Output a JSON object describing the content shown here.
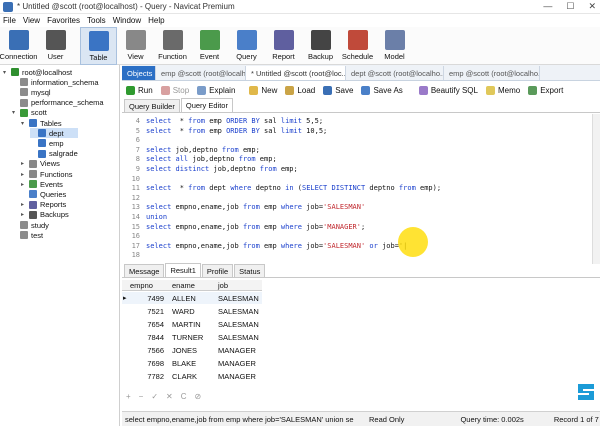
{
  "window": {
    "title": "* Untitled @scott (root@localhost) - Query - Navicat Premium",
    "min": "—",
    "max": "☐",
    "close": "✕"
  },
  "menu": [
    "File",
    "View",
    "Favorites",
    "Tools",
    "Window",
    "Help"
  ],
  "toolbar": [
    {
      "label": "Connection",
      "color": "#3a6fb5"
    },
    {
      "label": "User",
      "color": "#555555"
    },
    {
      "label": "Table",
      "color": "#3a74c4",
      "active": true
    },
    {
      "label": "View",
      "color": "#888888"
    },
    {
      "label": "Function",
      "color": "#6a6a6a"
    },
    {
      "label": "Event",
      "color": "#4b9a4b"
    },
    {
      "label": "Query",
      "color": "#4a7fc9"
    },
    {
      "label": "Report",
      "color": "#5f5f9f"
    },
    {
      "label": "Backup",
      "color": "#444444"
    },
    {
      "label": "Schedule",
      "color": "#c04a3a"
    },
    {
      "label": "Model",
      "color": "#6b7fa8"
    }
  ],
  "sidebar": {
    "items": [
      {
        "label": "root@localhost",
        "level": 0,
        "expander": "▾",
        "color": "#2f8f2f"
      },
      {
        "label": "information_schema",
        "level": 1,
        "expander": "",
        "color": "#8c8c8c"
      },
      {
        "label": "mysql",
        "level": 1,
        "expander": "",
        "color": "#8c8c8c"
      },
      {
        "label": "performance_schema",
        "level": 1,
        "expander": "",
        "color": "#8c8c8c"
      },
      {
        "label": "scott",
        "level": 1,
        "expander": "▾",
        "color": "#3a9a3a"
      },
      {
        "label": "Tables",
        "level": 2,
        "expander": "▾",
        "color": "#3a74c4"
      },
      {
        "label": "dept",
        "level": 3,
        "expander": "",
        "color": "#3a74c4",
        "selected": true
      },
      {
        "label": "emp",
        "level": 3,
        "expander": "",
        "color": "#3a74c4"
      },
      {
        "label": "salgrade",
        "level": 3,
        "expander": "",
        "color": "#3a74c4"
      },
      {
        "label": "Views",
        "level": 2,
        "expander": "▸",
        "color": "#888888"
      },
      {
        "label": "Functions",
        "level": 2,
        "expander": "▸",
        "color": "#888888"
      },
      {
        "label": "Events",
        "level": 2,
        "expander": "▸",
        "color": "#4b9a4b"
      },
      {
        "label": "Queries",
        "level": 2,
        "expander": "",
        "color": "#4a7fc9"
      },
      {
        "label": "Reports",
        "level": 2,
        "expander": "▸",
        "color": "#5f5f9f"
      },
      {
        "label": "Backups",
        "level": 2,
        "expander": "▸",
        "color": "#555555"
      },
      {
        "label": "study",
        "level": 1,
        "expander": "",
        "color": "#8c8c8c"
      },
      {
        "label": "test",
        "level": 1,
        "expander": "",
        "color": "#8c8c8c"
      }
    ]
  },
  "object_tabs": [
    "Objects",
    "emp @scott (root@localhos...",
    "* Untitled @scott (root@loc...",
    "dept @scott (root@localho...",
    "emp @scott (root@localho..."
  ],
  "query_toolbar": {
    "run": "Run",
    "stop": "Stop",
    "explain": "Explain",
    "new": "New",
    "load": "Load",
    "save": "Save",
    "save_as": "Save As",
    "beautify": "Beautify SQL",
    "memo": "Memo",
    "export": "Export"
  },
  "sub_tabs": [
    "Query Builder",
    "Query Editor"
  ],
  "editor": {
    "lines": [
      {
        "n": "4",
        "parts": [
          [
            "kw",
            "select"
          ],
          [
            "",
            "  * "
          ],
          [
            "kw",
            "from"
          ],
          [
            "",
            " emp "
          ],
          [
            "kw",
            "ORDER BY"
          ],
          [
            "",
            " sal "
          ],
          [
            "kw",
            "limit"
          ],
          [
            "",
            " 5,5;"
          ]
        ]
      },
      {
        "n": "5",
        "parts": [
          [
            "kw",
            "select"
          ],
          [
            "",
            "  * "
          ],
          [
            "kw",
            "from"
          ],
          [
            "",
            " emp "
          ],
          [
            "kw",
            "ORDER BY"
          ],
          [
            "",
            " sal "
          ],
          [
            "kw",
            "limit"
          ],
          [
            "",
            " 10,5;"
          ]
        ]
      },
      {
        "n": "6",
        "parts": []
      },
      {
        "n": "7",
        "parts": [
          [
            "kw",
            "select"
          ],
          [
            "",
            " job,deptno "
          ],
          [
            "kw",
            "from"
          ],
          [
            "",
            " emp;"
          ]
        ]
      },
      {
        "n": "8",
        "parts": [
          [
            "kw",
            "select all"
          ],
          [
            "",
            " job,deptno "
          ],
          [
            "kw",
            "from"
          ],
          [
            "",
            " emp;"
          ]
        ]
      },
      {
        "n": "9",
        "parts": [
          [
            "kw",
            "select distinct"
          ],
          [
            "",
            " job,deptno "
          ],
          [
            "kw",
            "from"
          ],
          [
            "",
            " emp;"
          ]
        ]
      },
      {
        "n": "10",
        "parts": []
      },
      {
        "n": "11",
        "parts": [
          [
            "kw",
            "select"
          ],
          [
            "",
            "  * "
          ],
          [
            "kw",
            "from"
          ],
          [
            "",
            " dept "
          ],
          [
            "kw",
            "where"
          ],
          [
            "",
            " deptno "
          ],
          [
            "kw",
            "in"
          ],
          [
            "",
            " ("
          ],
          [
            "kw",
            "SELECT DISTINCT"
          ],
          [
            "",
            " deptno "
          ],
          [
            "kw",
            "from"
          ],
          [
            "",
            " emp);"
          ]
        ]
      },
      {
        "n": "12",
        "parts": []
      },
      {
        "n": "13",
        "parts": [
          [
            "kw",
            "select"
          ],
          [
            "",
            " empno,ename,job "
          ],
          [
            "kw",
            "from"
          ],
          [
            "",
            " emp "
          ],
          [
            "kw",
            "where"
          ],
          [
            "",
            " job="
          ],
          [
            "str",
            "'SALESMAN'"
          ]
        ]
      },
      {
        "n": "14",
        "parts": [
          [
            "kw",
            "union"
          ]
        ]
      },
      {
        "n": "15",
        "parts": [
          [
            "kw",
            "select"
          ],
          [
            "",
            " empno,ename,job "
          ],
          [
            "kw",
            "from"
          ],
          [
            "",
            " emp "
          ],
          [
            "kw",
            "where"
          ],
          [
            "",
            " job="
          ],
          [
            "str",
            "'MANAGER'"
          ],
          [
            "",
            ";"
          ]
        ]
      },
      {
        "n": "16",
        "parts": []
      },
      {
        "n": "17",
        "parts": [
          [
            "kw",
            "select"
          ],
          [
            "",
            " empno,ename,job "
          ],
          [
            "kw",
            "from"
          ],
          [
            "",
            " emp "
          ],
          [
            "kw",
            "where"
          ],
          [
            "",
            " job="
          ],
          [
            "str",
            "'SALESMAN'"
          ],
          [
            "",
            " "
          ],
          [
            "kw",
            "or"
          ],
          [
            "",
            " job='|"
          ]
        ]
      },
      {
        "n": "18",
        "parts": []
      }
    ]
  },
  "result_tabs": [
    "Message",
    "Result1",
    "Profile",
    "Status"
  ],
  "grid": {
    "columns": [
      "empno",
      "ename",
      "job"
    ],
    "rows": [
      [
        "7499",
        "ALLEN",
        "SALESMAN"
      ],
      [
        "7521",
        "WARD",
        "SALESMAN"
      ],
      [
        "7654",
        "MARTIN",
        "SALESMAN"
      ],
      [
        "7844",
        "TURNER",
        "SALESMAN"
      ],
      [
        "7566",
        "JONES",
        "MANAGER"
      ],
      [
        "7698",
        "BLAKE",
        "MANAGER"
      ],
      [
        "7782",
        "CLARK",
        "MANAGER"
      ]
    ]
  },
  "grid_footer": [
    "+",
    "−",
    "✓",
    "✕",
    "C",
    "⊘"
  ],
  "status": {
    "sql": "select empno,ename,job from emp where job='SALESMAN' union  se",
    "mode": "Read Only",
    "time": "Query time: 0.002s",
    "record": "Record 1 of 7"
  }
}
